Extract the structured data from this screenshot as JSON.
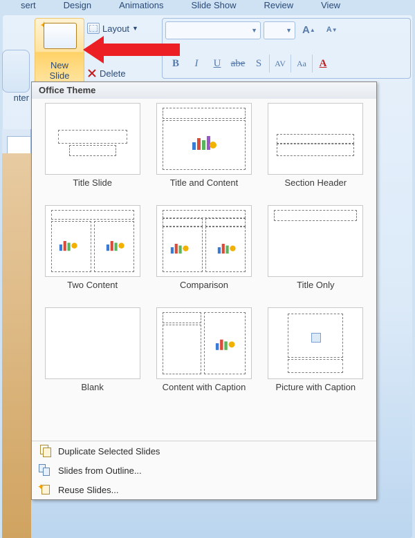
{
  "tabs": [
    "sert",
    "Design",
    "Animations",
    "Slide Show",
    "Review",
    "View"
  ],
  "slides_group_label": "nter",
  "new_slide_label": "New\nSlide",
  "layout_label": "Layout",
  "delete_label": "Delete",
  "popup_header": "Office Theme",
  "layouts": [
    {
      "name": "Title Slide"
    },
    {
      "name": "Title and Content"
    },
    {
      "name": "Section Header"
    },
    {
      "name": "Two Content"
    },
    {
      "name": "Comparison"
    },
    {
      "name": "Title Only"
    },
    {
      "name": "Blank"
    },
    {
      "name": "Content with Caption"
    },
    {
      "name": "Picture with Caption"
    }
  ],
  "bottom_items": {
    "duplicate": "Duplicate Selected Slides",
    "outline": "Slides from Outline...",
    "reuse": "Reuse Slides..."
  },
  "font_buttons": {
    "b": "B",
    "i": "I",
    "u": "U",
    "strike": "abe",
    "shadow": "S",
    "spacing": "AV",
    "case": "Aa",
    "color": "A"
  },
  "font_grow": "A",
  "font_shrink": "A"
}
